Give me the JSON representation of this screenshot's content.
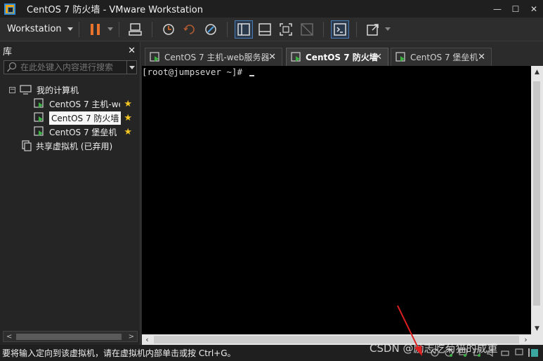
{
  "window": {
    "title": "CentOS 7 防火墙 - VMware Workstation",
    "minimize": "—",
    "maximize": "☐",
    "close": "✕"
  },
  "toolbar": {
    "workstation_menu": "Workstation",
    "buttons": [
      "pause-icon",
      "send-ctrl-alt-del-icon",
      "snapshot-icon",
      "revert-snapshot-icon",
      "snapshot-manager-icon",
      "show-library-icon",
      "thumbnail-icon",
      "fullscreen-icon",
      "unity-icon",
      "console-view-icon",
      "stretch-icon"
    ]
  },
  "library": {
    "title": "库",
    "close": "✕",
    "search_placeholder": "在此处键入内容进行搜索",
    "tree": {
      "root": "我的计算机",
      "expander": "−",
      "vms": [
        {
          "label": "CentOS 7 主机-web服务器",
          "favorite": true
        },
        {
          "label": "CentOS 7 防火墙",
          "favorite": true,
          "selected": true
        },
        {
          "label": "CentOS 7 堡垒机",
          "favorite": true
        }
      ],
      "shared": "共享虚拟机 (已弃用)"
    }
  },
  "tabs": [
    {
      "label": "CentOS 7 主机-web服务器",
      "close": "✕",
      "active": false
    },
    {
      "label": "CentOS 7 防火墙",
      "close": "✕",
      "active": true
    },
    {
      "label": "CentOS 7 堡垒机",
      "close": "✕",
      "active": false
    }
  ],
  "console": {
    "prompt": "[root@jumpsever ~]# "
  },
  "statusbar": {
    "message": "要将输入定向到该虚拟机，请在虚拟机内部单击或按 Ctrl+G。"
  },
  "watermark": "CSDN @励志吃菊猫的成重",
  "colors": {
    "accent": "#2f8fdc",
    "pause": "#e8742c",
    "star": "#f3c623",
    "vm_green": "#3cb043"
  }
}
